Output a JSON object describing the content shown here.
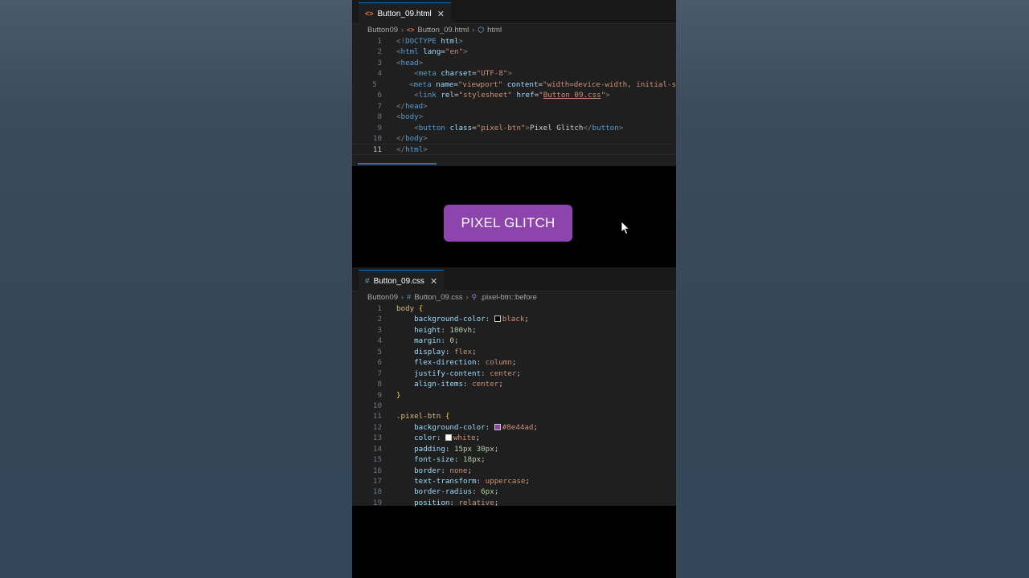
{
  "html_editor": {
    "tab_label": "Button_09.html",
    "close_glyph": "✕",
    "breadcrumb": [
      "Button09",
      "Button_09.html",
      "html"
    ],
    "current_line": 11,
    "lines": [
      [
        [
          "tg",
          "<!"
        ],
        [
          "tn",
          "DOCTYPE"
        ],
        [
          "pl",
          " "
        ],
        [
          "an",
          "html"
        ],
        [
          "tg",
          ">"
        ]
      ],
      [
        [
          "tg",
          "<"
        ],
        [
          "tn",
          "html"
        ],
        [
          "pl",
          " "
        ],
        [
          "an",
          "lang"
        ],
        [
          "pl",
          "="
        ],
        [
          "av",
          "\"en\""
        ],
        [
          "tg",
          ">"
        ]
      ],
      [
        [
          "tg",
          "<"
        ],
        [
          "tn",
          "head"
        ],
        [
          "tg",
          ">"
        ]
      ],
      [
        [
          "pl",
          "    "
        ],
        [
          "tg",
          "<"
        ],
        [
          "tn",
          "meta"
        ],
        [
          "pl",
          " "
        ],
        [
          "an",
          "charset"
        ],
        [
          "pl",
          "="
        ],
        [
          "av",
          "\"UTF-8\""
        ],
        [
          "tg",
          ">"
        ]
      ],
      [
        [
          "pl",
          "    "
        ],
        [
          "tg",
          "<"
        ],
        [
          "tn",
          "meta"
        ],
        [
          "pl",
          " "
        ],
        [
          "an",
          "name"
        ],
        [
          "pl",
          "="
        ],
        [
          "av",
          "\"viewport\""
        ],
        [
          "pl",
          " "
        ],
        [
          "an",
          "content"
        ],
        [
          "pl",
          "="
        ],
        [
          "av",
          "\"width=device-width, initial-s"
        ]
      ],
      [
        [
          "pl",
          "    "
        ],
        [
          "tg",
          "<"
        ],
        [
          "tn",
          "link"
        ],
        [
          "pl",
          " "
        ],
        [
          "an",
          "rel"
        ],
        [
          "pl",
          "="
        ],
        [
          "av",
          "\"stylesheet\""
        ],
        [
          "pl",
          " "
        ],
        [
          "an",
          "href"
        ],
        [
          "pl",
          "="
        ],
        [
          "av",
          "\""
        ],
        [
          "av-u",
          "Button_09.css"
        ],
        [
          "av",
          "\""
        ],
        [
          "tg",
          ">"
        ]
      ],
      [
        [
          "tg",
          "</"
        ],
        [
          "tn",
          "head"
        ],
        [
          "tg",
          ">"
        ]
      ],
      [
        [
          "tg",
          "<"
        ],
        [
          "tn",
          "body"
        ],
        [
          "tg",
          ">"
        ]
      ],
      [
        [
          "pl",
          "    "
        ],
        [
          "tg",
          "<"
        ],
        [
          "tn",
          "button"
        ],
        [
          "pl",
          " "
        ],
        [
          "an",
          "class"
        ],
        [
          "pl",
          "="
        ],
        [
          "av",
          "\"pixel-btn\""
        ],
        [
          "tg",
          ">"
        ],
        [
          "pl",
          "Pixel Glitch"
        ],
        [
          "tg",
          "</"
        ],
        [
          "tn",
          "button"
        ],
        [
          "tg",
          ">"
        ]
      ],
      [
        [
          "tg",
          "</"
        ],
        [
          "tn",
          "body"
        ],
        [
          "tg",
          ">"
        ]
      ],
      [
        [
          "tg",
          "</"
        ],
        [
          "tn",
          "html"
        ],
        [
          "tg",
          ">"
        ]
      ]
    ]
  },
  "preview": {
    "button_label": "Pixel Glitch",
    "button_color": "#8e44ad"
  },
  "css_editor": {
    "tab_label": "Button_09.css",
    "close_glyph": "✕",
    "breadcrumb": [
      "Button09",
      "Button_09.css",
      ".pixel-btn::before"
    ],
    "lines": [
      [
        [
          "sel",
          "body"
        ],
        [
          "pl",
          " "
        ],
        [
          "br",
          "{"
        ]
      ],
      [
        [
          "pl",
          "    "
        ],
        [
          "pn",
          "background-color"
        ],
        [
          "pl",
          ": "
        ],
        [
          "sw",
          "#000000"
        ],
        [
          "vl",
          "black"
        ],
        [
          "pl",
          ";"
        ]
      ],
      [
        [
          "pl",
          "    "
        ],
        [
          "pn",
          "height"
        ],
        [
          "pl",
          ": "
        ],
        [
          "nm",
          "100vh"
        ],
        [
          "pl",
          ";"
        ]
      ],
      [
        [
          "pl",
          "    "
        ],
        [
          "pn",
          "margin"
        ],
        [
          "pl",
          ": "
        ],
        [
          "nm",
          "0"
        ],
        [
          "pl",
          ";"
        ]
      ],
      [
        [
          "pl",
          "    "
        ],
        [
          "pn",
          "display"
        ],
        [
          "pl",
          ": "
        ],
        [
          "vl",
          "flex"
        ],
        [
          "pl",
          ";"
        ]
      ],
      [
        [
          "pl",
          "    "
        ],
        [
          "pn",
          "flex-direction"
        ],
        [
          "pl",
          ": "
        ],
        [
          "vl",
          "column"
        ],
        [
          "pl",
          ";"
        ]
      ],
      [
        [
          "pl",
          "    "
        ],
        [
          "pn",
          "justify-content"
        ],
        [
          "pl",
          ": "
        ],
        [
          "vl",
          "center"
        ],
        [
          "pl",
          ";"
        ]
      ],
      [
        [
          "pl",
          "    "
        ],
        [
          "pn",
          "align-items"
        ],
        [
          "pl",
          ": "
        ],
        [
          "vl",
          "center"
        ],
        [
          "pl",
          ";"
        ]
      ],
      [
        [
          "br",
          "}"
        ]
      ],
      [],
      [
        [
          "sel",
          ".pixel-btn"
        ],
        [
          "pl",
          " "
        ],
        [
          "br",
          "{"
        ]
      ],
      [
        [
          "pl",
          "    "
        ],
        [
          "pn",
          "background-color"
        ],
        [
          "pl",
          ": "
        ],
        [
          "sw",
          "#8e44ad"
        ],
        [
          "vl",
          "#8e44ad"
        ],
        [
          "pl",
          ";"
        ]
      ],
      [
        [
          "pl",
          "    "
        ],
        [
          "pn",
          "color"
        ],
        [
          "pl",
          ": "
        ],
        [
          "sw",
          "#ffffff"
        ],
        [
          "vl",
          "white"
        ],
        [
          "pl",
          ";"
        ]
      ],
      [
        [
          "pl",
          "    "
        ],
        [
          "pn",
          "padding"
        ],
        [
          "pl",
          ": "
        ],
        [
          "nm",
          "15px 30px"
        ],
        [
          "pl",
          ";"
        ]
      ],
      [
        [
          "pl",
          "    "
        ],
        [
          "pn",
          "font-size"
        ],
        [
          "pl",
          ": "
        ],
        [
          "nm",
          "18px"
        ],
        [
          "pl",
          ";"
        ]
      ],
      [
        [
          "pl",
          "    "
        ],
        [
          "pn",
          "border"
        ],
        [
          "pl",
          ": "
        ],
        [
          "vl",
          "none"
        ],
        [
          "pl",
          ";"
        ]
      ],
      [
        [
          "pl",
          "    "
        ],
        [
          "pn",
          "text-transform"
        ],
        [
          "pl",
          ": "
        ],
        [
          "vl",
          "uppercase"
        ],
        [
          "pl",
          ";"
        ]
      ],
      [
        [
          "pl",
          "    "
        ],
        [
          "pn",
          "border-radius"
        ],
        [
          "pl",
          ": "
        ],
        [
          "nm",
          "6px"
        ],
        [
          "pl",
          ";"
        ]
      ],
      [
        [
          "pl",
          "    "
        ],
        [
          "pn",
          "position"
        ],
        [
          "pl",
          ": "
        ],
        [
          "vl",
          "relative"
        ],
        [
          "pl",
          ";"
        ]
      ]
    ]
  }
}
